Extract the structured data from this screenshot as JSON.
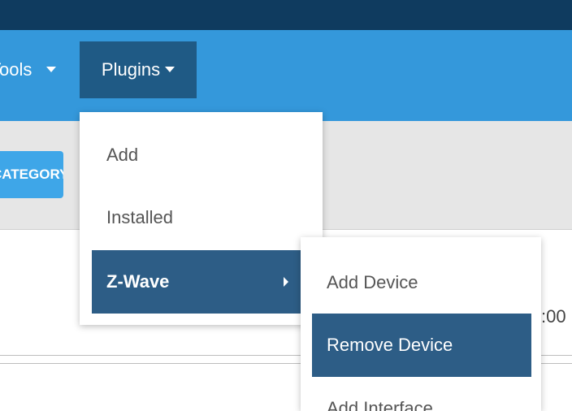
{
  "nav": {
    "tools_label": "Tools",
    "plugins_label": "Plugins"
  },
  "subbar": {
    "category_button": "CATEGORY"
  },
  "content": {
    "clipped_value": ":00"
  },
  "plugins_menu": {
    "items": [
      {
        "label": "Add"
      },
      {
        "label": "Installed"
      },
      {
        "label": "Z-Wave"
      }
    ]
  },
  "zwave_submenu": {
    "items": [
      {
        "label": "Add Device"
      },
      {
        "label": "Remove Device"
      },
      {
        "label": "Add Interface"
      }
    ]
  },
  "colors": {
    "topbar": "#0f3b5f",
    "navbar": "#3498db",
    "active_item": "#2d5d86",
    "subbar": "#e6e6e6"
  }
}
